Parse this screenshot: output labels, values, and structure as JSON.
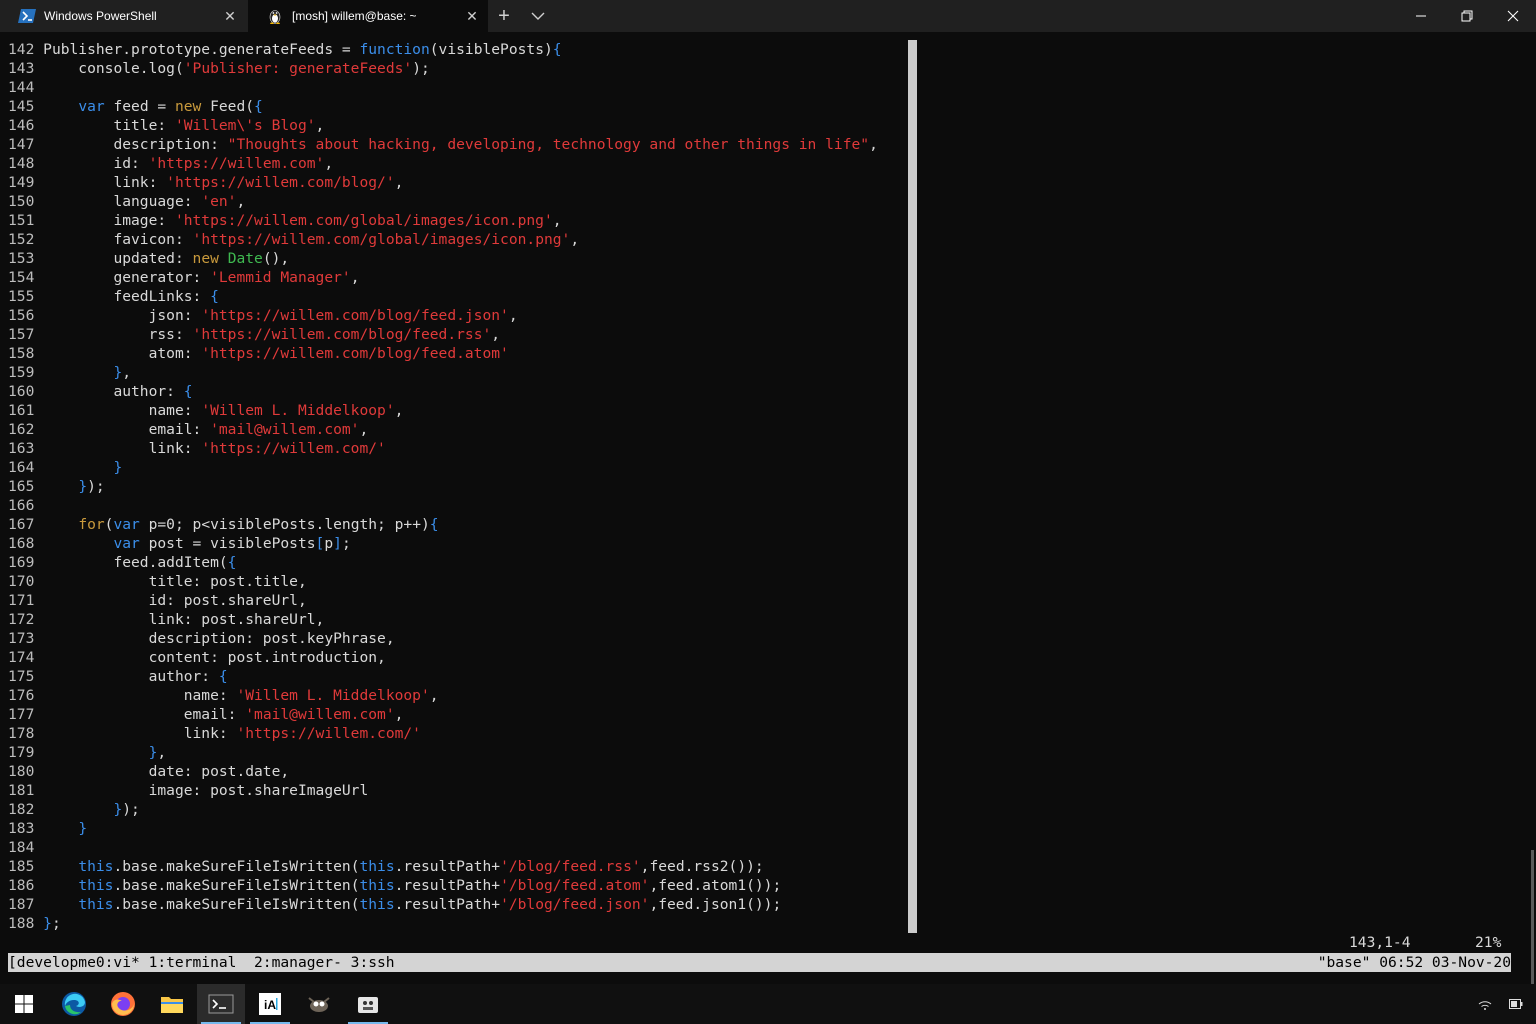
{
  "tabs": [
    {
      "label": "Windows PowerShell",
      "icon": "powershell-icon"
    },
    {
      "label": "[mosh] willem@base: ~",
      "icon": "linux-penguin-icon"
    }
  ],
  "window_controls": [
    "minimize-icon",
    "restore-icon",
    "close-icon"
  ],
  "editor": {
    "lines": [
      {
        "n": "142",
        "parts": [
          [
            "",
            "Publisher.prototype.generateFeeds = "
          ],
          [
            "kw",
            "function"
          ],
          [
            "",
            "(visiblePosts)"
          ],
          [
            "br",
            "{"
          ]
        ]
      },
      {
        "n": "143",
        "parts": [
          [
            "",
            "    console.log("
          ],
          [
            "str",
            "'Publisher: generateFeeds'"
          ],
          [
            "",
            ");"
          ]
        ]
      },
      {
        "n": "144",
        "parts": []
      },
      {
        "n": "145",
        "parts": [
          [
            "",
            "    "
          ],
          [
            "kw",
            "var"
          ],
          [
            "",
            " feed = "
          ],
          [
            "kw2",
            "new"
          ],
          [
            "",
            "",
            " Feed("
          ],
          [
            "br",
            "{"
          ]
        ]
      },
      {
        "n": "146",
        "parts": [
          [
            "",
            "        title: "
          ],
          [
            "str",
            "'Willem\\'s Blog'"
          ],
          [
            "",
            ","
          ]
        ]
      },
      {
        "n": "147",
        "parts": [
          [
            "",
            "        description: "
          ],
          [
            "str",
            "\"Thoughts about hacking, developing, technology and other things in life\""
          ],
          [
            "",
            ","
          ]
        ]
      },
      {
        "n": "148",
        "parts": [
          [
            "",
            "        id: "
          ],
          [
            "str",
            "'https://willem.com'"
          ],
          [
            "",
            ","
          ]
        ]
      },
      {
        "n": "149",
        "parts": [
          [
            "",
            "        link: "
          ],
          [
            "str",
            "'https://willem.com/blog/'"
          ],
          [
            "",
            ","
          ]
        ]
      },
      {
        "n": "150",
        "parts": [
          [
            "",
            "        language: "
          ],
          [
            "str",
            "'en'"
          ],
          [
            "",
            ","
          ]
        ]
      },
      {
        "n": "151",
        "parts": [
          [
            "",
            "        image: "
          ],
          [
            "str",
            "'https://willem.com/global/images/icon.png'"
          ],
          [
            "",
            ","
          ]
        ]
      },
      {
        "n": "152",
        "parts": [
          [
            "",
            "        favicon: "
          ],
          [
            "str",
            "'https://willem.com/global/images/icon.png'"
          ],
          [
            "",
            ","
          ]
        ]
      },
      {
        "n": "153",
        "parts": [
          [
            "",
            "        updated: "
          ],
          [
            "kw2",
            "new"
          ],
          [
            "",
            " "
          ],
          [
            "cls",
            "Date"
          ],
          [
            "",
            "(),"
          ]
        ]
      },
      {
        "n": "154",
        "parts": [
          [
            "",
            "        generator: "
          ],
          [
            "str",
            "'Lemmid Manager'"
          ],
          [
            "",
            ","
          ]
        ]
      },
      {
        "n": "155",
        "parts": [
          [
            "",
            "        feedLinks: "
          ],
          [
            "br",
            "{"
          ]
        ]
      },
      {
        "n": "156",
        "parts": [
          [
            "",
            "            json: "
          ],
          [
            "str",
            "'https://willem.com/blog/feed.json'"
          ],
          [
            "",
            ","
          ]
        ]
      },
      {
        "n": "157",
        "parts": [
          [
            "",
            "            rss: "
          ],
          [
            "str",
            "'https://willem.com/blog/feed.rss'"
          ],
          [
            "",
            ","
          ]
        ]
      },
      {
        "n": "158",
        "parts": [
          [
            "",
            "            atom: "
          ],
          [
            "str",
            "'https://willem.com/blog/feed.atom'"
          ]
        ]
      },
      {
        "n": "159",
        "parts": [
          [
            "",
            "        "
          ],
          [
            "br",
            "}"
          ],
          [
            "",
            ","
          ]
        ]
      },
      {
        "n": "160",
        "parts": [
          [
            "",
            "        author: "
          ],
          [
            "br",
            "{"
          ]
        ]
      },
      {
        "n": "161",
        "parts": [
          [
            "",
            "            name: "
          ],
          [
            "str",
            "'Willem L. Middelkoop'"
          ],
          [
            "",
            ","
          ]
        ]
      },
      {
        "n": "162",
        "parts": [
          [
            "",
            "            email: "
          ],
          [
            "str",
            "'mail@willem.com'"
          ],
          [
            "",
            ","
          ]
        ]
      },
      {
        "n": "163",
        "parts": [
          [
            "",
            "            link: "
          ],
          [
            "str",
            "'https://willem.com/'"
          ]
        ]
      },
      {
        "n": "164",
        "parts": [
          [
            "",
            "        "
          ],
          [
            "br",
            "}"
          ]
        ]
      },
      {
        "n": "165",
        "parts": [
          [
            "",
            "    "
          ],
          [
            "br",
            "}"
          ],
          [
            "",
            ");"
          ]
        ]
      },
      {
        "n": "166",
        "parts": []
      },
      {
        "n": "167",
        "parts": [
          [
            "",
            "    "
          ],
          [
            "kw2",
            "for"
          ],
          [
            "",
            "("
          ],
          [
            "kw",
            "var"
          ],
          [
            "",
            " p=0; p<visiblePosts.length; p++)"
          ],
          [
            "br",
            "{"
          ]
        ]
      },
      {
        "n": "168",
        "parts": [
          [
            "",
            "        "
          ],
          [
            "kw",
            "var"
          ],
          [
            "",
            " post = visiblePosts"
          ],
          [
            "br",
            "["
          ],
          [
            "",
            "p"
          ],
          [
            "br",
            "]"
          ],
          [
            "",
            ";"
          ]
        ]
      },
      {
        "n": "169",
        "parts": [
          [
            "",
            "        feed.addItem("
          ],
          [
            "br",
            "{"
          ]
        ]
      },
      {
        "n": "170",
        "parts": [
          [
            "",
            "            title: post.title,"
          ]
        ]
      },
      {
        "n": "171",
        "parts": [
          [
            "",
            "            id: post.shareUrl,"
          ]
        ]
      },
      {
        "n": "172",
        "parts": [
          [
            "",
            "            link: post.shareUrl,"
          ]
        ]
      },
      {
        "n": "173",
        "parts": [
          [
            "",
            "            description: post.keyPhrase,"
          ]
        ]
      },
      {
        "n": "174",
        "parts": [
          [
            "",
            "            content: post.introduction,"
          ]
        ]
      },
      {
        "n": "175",
        "parts": [
          [
            "",
            "            author: "
          ],
          [
            "br",
            "{"
          ]
        ]
      },
      {
        "n": "176",
        "parts": [
          [
            "",
            "                name: "
          ],
          [
            "str",
            "'Willem L. Middelkoop'"
          ],
          [
            "",
            ","
          ]
        ]
      },
      {
        "n": "177",
        "parts": [
          [
            "",
            "                email: "
          ],
          [
            "str",
            "'mail@willem.com'"
          ],
          [
            "",
            ","
          ]
        ]
      },
      {
        "n": "178",
        "parts": [
          [
            "",
            "                link: "
          ],
          [
            "str",
            "'https://willem.com/'"
          ]
        ]
      },
      {
        "n": "179",
        "parts": [
          [
            "",
            "            "
          ],
          [
            "br",
            "}"
          ],
          [
            "",
            ","
          ]
        ]
      },
      {
        "n": "180",
        "parts": [
          [
            "",
            "            date: post.date,"
          ]
        ]
      },
      {
        "n": "181",
        "parts": [
          [
            "",
            "            image: post.shareImageUrl"
          ]
        ]
      },
      {
        "n": "182",
        "parts": [
          [
            "",
            "        "
          ],
          [
            "br",
            "}"
          ],
          [
            "",
            ");"
          ]
        ]
      },
      {
        "n": "183",
        "parts": [
          [
            "",
            "    "
          ],
          [
            "br",
            "}"
          ]
        ]
      },
      {
        "n": "184",
        "parts": []
      },
      {
        "n": "185",
        "parts": [
          [
            "",
            "    "
          ],
          [
            "kw",
            "this"
          ],
          [
            "",
            ".base.makeSureFileIsWritten("
          ],
          [
            "kw",
            "this"
          ],
          [
            "",
            ".resultPath+"
          ],
          [
            "str",
            "'/blog/feed.rss'"
          ],
          [
            "",
            ",feed.rss2());"
          ]
        ]
      },
      {
        "n": "186",
        "parts": [
          [
            "",
            "    "
          ],
          [
            "kw",
            "this"
          ],
          [
            "",
            ".base.makeSureFileIsWritten("
          ],
          [
            "kw",
            "this"
          ],
          [
            "",
            ".resultPath+"
          ],
          [
            "str",
            "'/blog/feed.atom'"
          ],
          [
            "",
            ",feed.atom1());"
          ]
        ]
      },
      {
        "n": "187",
        "parts": [
          [
            "",
            "    "
          ],
          [
            "kw",
            "this"
          ],
          [
            "",
            ".base.makeSureFileIsWritten("
          ],
          [
            "kw",
            "this"
          ],
          [
            "",
            ".resultPath+"
          ],
          [
            "str",
            "'/blog/feed.json'"
          ],
          [
            "",
            ",feed.json1());"
          ]
        ]
      },
      {
        "n": "188",
        "parts": [
          [
            "br",
            "}"
          ],
          [
            "",
            ";"
          ]
        ]
      }
    ]
  },
  "vim": {
    "ruler": "143,1-4",
    "percent": "21%"
  },
  "tmux": {
    "left": "[developme0:vi* 1:terminal  2:manager- 3:ssh",
    "right": "\"base\" 06:52 03-Nov-20"
  },
  "taskbar": {
    "apps": [
      "start-icon",
      "edge-icon",
      "firefox-icon",
      "file-explorer-icon",
      "terminal-icon",
      "ia-writer-icon",
      "gimp-icon",
      "app-icon"
    ],
    "active": "terminal-icon"
  },
  "colors": {
    "keyword": "#3b8eea",
    "keyword_alt": "#c99a3c",
    "string": "#e03a3a",
    "class": "#3fb950",
    "text": "#d9d9d9"
  }
}
